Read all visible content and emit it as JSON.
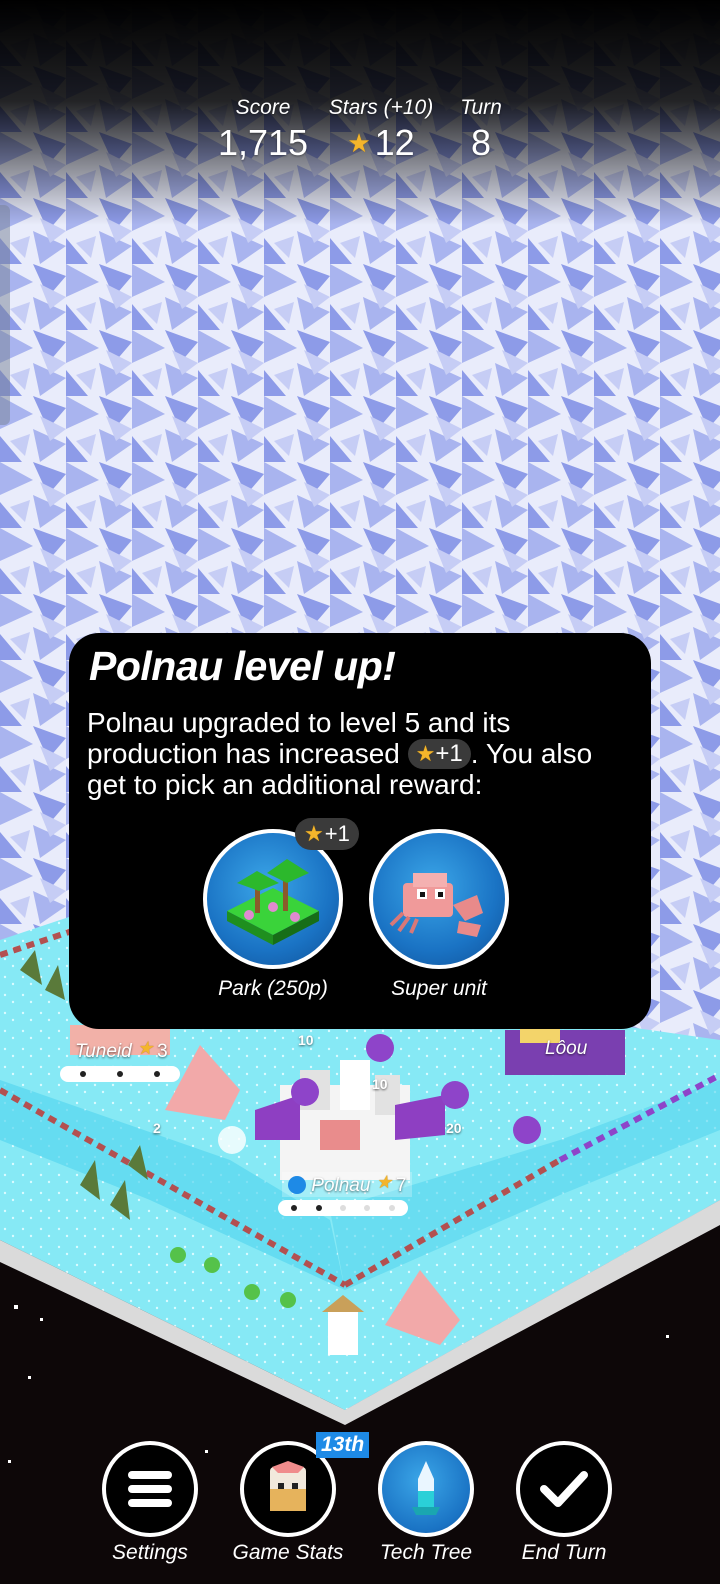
{
  "hud": {
    "score_label": "Score",
    "score_value": "1,715",
    "stars_label": "Stars (+10)",
    "stars_value": "12",
    "turn_label": "Turn",
    "turn_value": "8"
  },
  "popup": {
    "title": "Polnau level up!",
    "body_part1": "Polnau upgraded to level 5 and its production has increased",
    "body_pill": "+1",
    "body_part2": ". You also get to pick an additional reward:",
    "reward_badge": "+1",
    "choices": [
      {
        "label": "Park (250p)",
        "icon": "park-icon"
      },
      {
        "label": "Super unit",
        "icon": "crab-icon"
      }
    ]
  },
  "map": {
    "cities": [
      {
        "name": "Tuneid",
        "level": "3"
      },
      {
        "name": "Lôou",
        "level": ""
      },
      {
        "name": "Polnau",
        "level": "7"
      }
    ],
    "numbers": [
      "10",
      "10",
      "20",
      "2"
    ]
  },
  "bottom_bar": {
    "rank": "13th",
    "buttons": [
      {
        "label": "Settings",
        "icon": "menu-icon"
      },
      {
        "label": "Game Stats",
        "icon": "tribe-head-icon"
      },
      {
        "label": "Tech Tree",
        "icon": "tech-tree-icon"
      },
      {
        "label": "End Turn",
        "icon": "checkmark-icon"
      }
    ]
  },
  "colors": {
    "accent_blue": "#1e8ae6",
    "star_gold": "#f4b52b",
    "ice": "#7fe6f2",
    "purple_tribe": "#7a3fb0"
  }
}
